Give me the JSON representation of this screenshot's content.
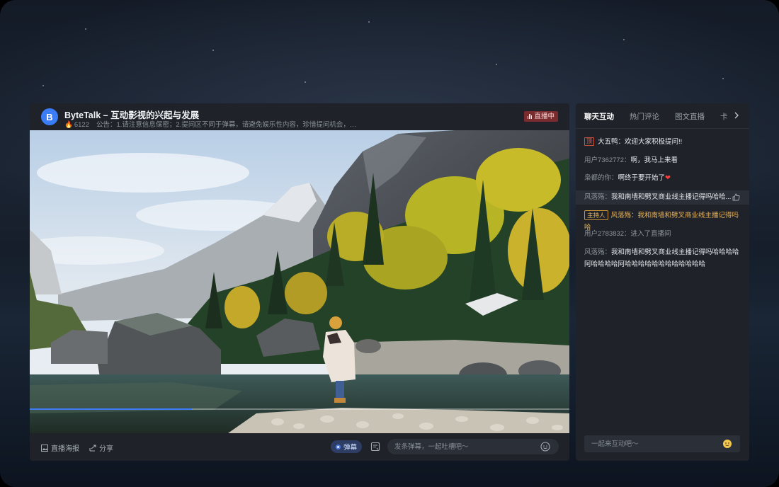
{
  "room": {
    "avatar_letter": "B",
    "title": "ByteTalk – 互动影视的兴起与发展",
    "viewers": "6122",
    "notice": "公告：1.请注意信息保密；2.提问区不同于弹幕，请避免娱乐性内容，珍惜提问机会，请...",
    "live_label": "直播中",
    "fire_icon": "fire-icon"
  },
  "video": {
    "progress_fraction": 0.3,
    "scene": "autumn-mountain-river"
  },
  "footer": {
    "poster_label": "直播海报",
    "share_label": "分享",
    "danmu_label": "弹幕",
    "danmu_placeholder": "发条弹幕，一起吐槽吧～"
  },
  "chat": {
    "tabs": [
      "聊天互动",
      "热门评论",
      "图文直播",
      "卡"
    ],
    "messages": [
      {
        "tag": "顶",
        "name": "大五鸭：",
        "text": "欢迎大家积极提问!!"
      },
      {
        "name": "用户7362772：",
        "text": "啊，我马上来看"
      },
      {
        "name": "枭都的你：",
        "text": "啊终于要开始了",
        "emoji": "❤"
      },
      {
        "name": "风落殇：",
        "text": "我和南墙和劈叉商业线主播记得吗哈哈..."
      },
      {
        "tag": "主持人",
        "name": "风落殇：",
        "text": "我和南墙和劈叉商业线主播记得吗哈"
      },
      {
        "name": "用户2783832：",
        "text": "进入了直播间"
      },
      {
        "name": "风落殇：",
        "text": "我和南墙和劈叉商业线主播记得吗哈哈哈哈阿哈哈哈哈阿哈哈哈哈哈哈哈哈哈哈哈哈"
      }
    ],
    "input_placeholder": "一起来互动吧～"
  },
  "colors": {
    "accent": "#3d7cf5",
    "live_badge": "#7a2b2e",
    "host_gold": "#e8b25a"
  }
}
